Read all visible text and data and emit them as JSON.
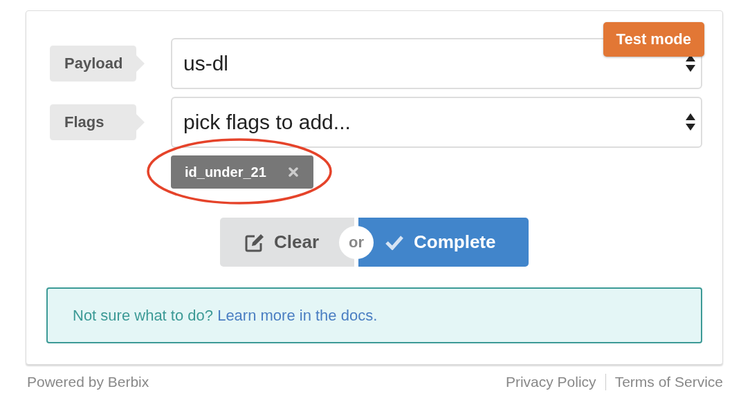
{
  "badge": "Test mode",
  "fields": [
    {
      "label": "Payload",
      "value": "us-dl"
    },
    {
      "label": "Flags",
      "value": "pick flags to add..."
    }
  ],
  "tags": [
    {
      "label": "id_under_21",
      "highlighted": true
    }
  ],
  "buttons": {
    "clear": "Clear",
    "or": "or",
    "complete": "Complete"
  },
  "help": {
    "text": "Not sure what to do?",
    "link": "Learn more in the docs."
  },
  "footer": {
    "powered_by": "Powered by Berbix",
    "links": [
      "Privacy Policy",
      "Terms of Service"
    ]
  }
}
